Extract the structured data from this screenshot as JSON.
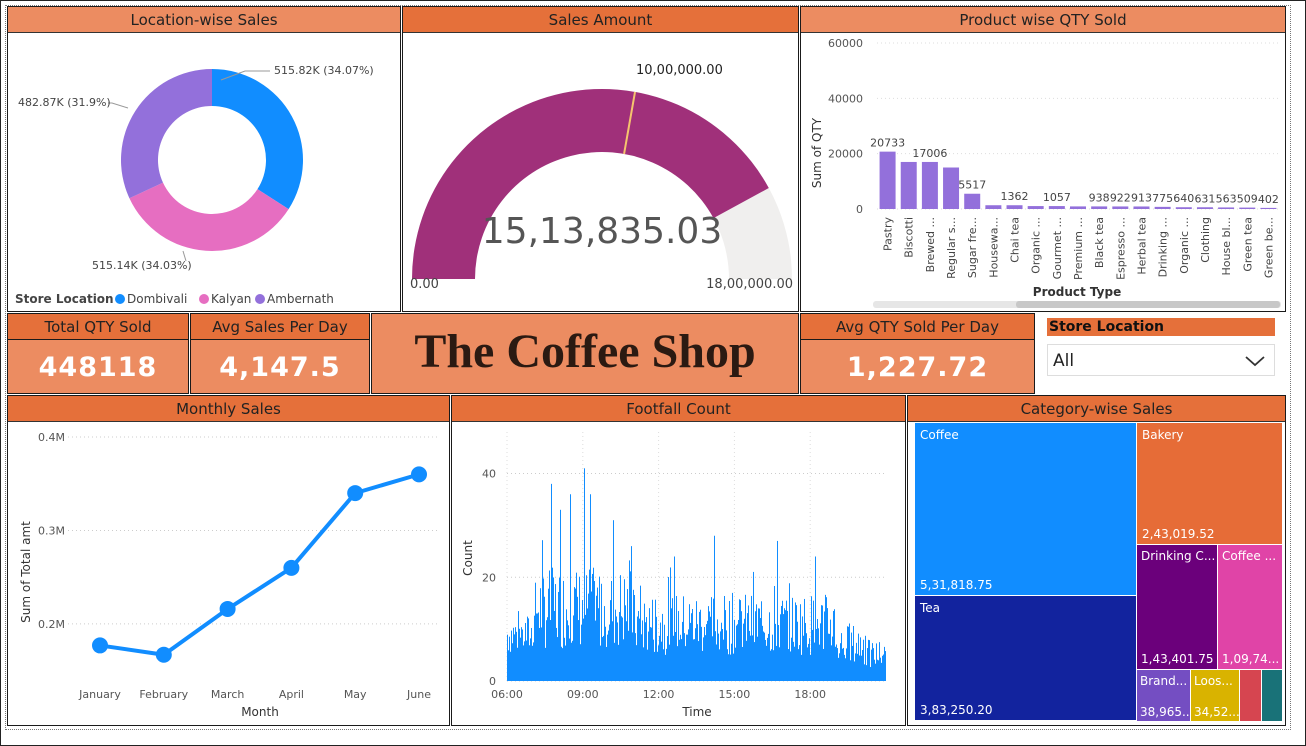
{
  "location_sales": {
    "title": "Location-wise Sales",
    "legend_title": "Store Location",
    "colors": {
      "Dombivali": "#118dff",
      "Kalyan": "#e66ec1",
      "Ambernath": "#9370db"
    },
    "labels": {
      "dombivali": "515.82K (34.07%)",
      "kalyan": "515.14K (34.03%)",
      "ambernath": "482.87K (31.9%)"
    },
    "legend": [
      "Dombivali",
      "Kalyan",
      "Ambernath"
    ],
    "chart_data": {
      "type": "pie",
      "categories": [
        "Dombivali",
        "Kalyan",
        "Ambernath"
      ],
      "values": [
        515.82,
        515.14,
        482.87
      ],
      "unit": "K"
    }
  },
  "sales_amount": {
    "title": "Sales Amount",
    "value": "15,13,835.03",
    "min_label": "0.00",
    "max_label": "18,00,000.00",
    "target_label": "10,00,000.00",
    "fill_fraction": 0.841,
    "target_fraction": 0.5556,
    "fill_color": "#a0307a"
  },
  "product_qty": {
    "title": "Product wise QTY Sold",
    "xlabel": "Product Type",
    "ylabel": "Sum of QTY",
    "chart_data": {
      "type": "bar",
      "categories": [
        "Pastry",
        "Biscotti",
        "Brewed ...",
        "Regular s...",
        "Sugar fre...",
        "Housewa...",
        "Chai tea",
        "Organic ...",
        "Gourmet ...",
        "Premium ...",
        "Black tea",
        "Espresso ...",
        "Herbal tea",
        "Drinking ...",
        "Organic ...",
        "Clothing",
        "House bl...",
        "Green tea",
        "Green be..."
      ],
      "values": [
        20733,
        17006,
        17006,
        15000,
        5517,
        1362,
        1362,
        1057,
        1057,
        938,
        938,
        922,
        913,
        775,
        640,
        631,
        563,
        509,
        402
      ],
      "data_labels": [
        "20733",
        "",
        "17006",
        "",
        "5517",
        "",
        "1362",
        "",
        "1057",
        "",
        "938",
        "922",
        "913",
        "775",
        "640",
        "631",
        "563",
        "509",
        "402"
      ],
      "ylim": [
        0,
        60000
      ],
      "yticks": [
        "0",
        "20000",
        "40000",
        "60000"
      ],
      "bar_color": "#9370db"
    }
  },
  "kpis": {
    "total_qty": {
      "title": "Total QTY Sold",
      "value": "448118"
    },
    "avg_sales": {
      "title": "Avg Sales Per Day",
      "value": "4,147.5"
    },
    "avg_qty": {
      "title": "Avg QTY Sold Per Day",
      "value": "1,227.72"
    }
  },
  "banner": {
    "title": "The Coffee Shop"
  },
  "slicer": {
    "title": "Store Location",
    "value": "All"
  },
  "monthly_sales": {
    "title": "Monthly Sales",
    "xlabel": "Month",
    "ylabel": "Sum of Total amt",
    "chart_data": {
      "type": "line",
      "categories": [
        "January",
        "February",
        "March",
        "April",
        "May",
        "June"
      ],
      "values": [
        0.177,
        0.167,
        0.216,
        0.26,
        0.34,
        0.36
      ],
      "ylim": [
        0.14,
        0.4
      ],
      "yticks": [
        {
          "v": 0.2,
          "t": "0.2M"
        },
        {
          "v": 0.3,
          "t": "0.3M"
        },
        {
          "v": 0.4,
          "t": "0.4M"
        }
      ],
      "color": "#118dff"
    }
  },
  "footfall": {
    "title": "Footfall Count",
    "xlabel": "Time",
    "ylabel": "Count",
    "chart_data": {
      "type": "bar",
      "x_range": [
        "06:00",
        "21:00"
      ],
      "xticks": [
        "06:00",
        "09:00",
        "12:00",
        "15:00",
        "18:00"
      ],
      "ylim": [
        0,
        48
      ],
      "yticks": [
        0,
        20,
        40
      ],
      "peaks": [
        [
          7.75,
          38
        ],
        [
          8.5,
          36
        ],
        [
          9.05,
          41
        ],
        [
          9.3,
          36
        ],
        [
          10.2,
          31
        ],
        [
          8.1,
          33
        ],
        [
          10.9,
          26
        ],
        [
          14.2,
          28
        ],
        [
          12.6,
          24
        ],
        [
          16.7,
          27
        ],
        [
          18.2,
          24
        ]
      ],
      "color": "#118dff"
    }
  },
  "category_sales": {
    "title": "Category-wise Sales",
    "chart_data": {
      "type": "treemap",
      "categories": [
        "Coffee",
        "Tea",
        "Bakery",
        "Drinking Chocolate",
        "Coffee beans",
        "Branded",
        "Loose Tea"
      ],
      "values": [
        531818.75,
        383250.2,
        243019.52,
        143401.75,
        109740,
        38965,
        34520
      ]
    },
    "tiles": [
      {
        "name": "Coffee",
        "value": "5,31,818.75",
        "color": "#118dff"
      },
      {
        "name": "Tea",
        "value": "3,83,250.20",
        "color": "#12239e"
      },
      {
        "name": "Bakery",
        "value": "2,43,019.52",
        "color": "#e66c37"
      },
      {
        "name": "Drinking C...",
        "value": "1,43,401.75",
        "color": "#6b007b"
      },
      {
        "name": "Coffee ...",
        "value": "1,09,74...",
        "color": "#e044a7"
      },
      {
        "name": "Brand...",
        "value": "38,965...",
        "color": "#744ec2"
      },
      {
        "name": "Loos...",
        "value": "34,52...",
        "color": "#d9b300"
      },
      {
        "name": "",
        "value": "",
        "color": "#d64550"
      },
      {
        "name": "",
        "value": "",
        "color": "#197278"
      }
    ]
  }
}
